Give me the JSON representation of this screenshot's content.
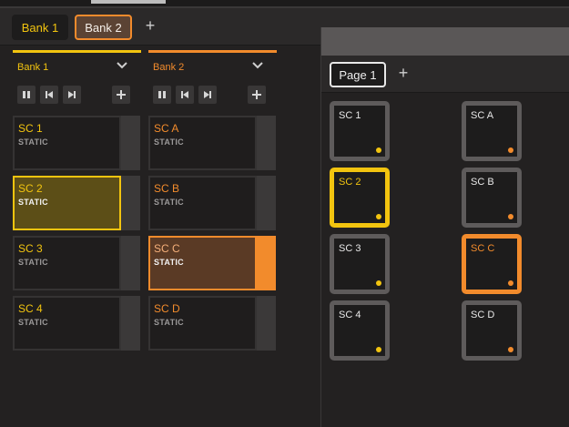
{
  "banks": {
    "tabs": [
      {
        "label": "Bank 1"
      },
      {
        "label": "Bank 2"
      }
    ],
    "add_icon": "plus-icon"
  },
  "columns": [
    {
      "title": "Bank 1",
      "accent": "#f2c40f",
      "clips": [
        {
          "name": "SC 1",
          "mode": "STATIC"
        },
        {
          "name": "SC 2",
          "mode": "STATIC"
        },
        {
          "name": "SC 3",
          "mode": "STATIC"
        },
        {
          "name": "SC 4",
          "mode": "STATIC"
        }
      ]
    },
    {
      "title": "Bank 2",
      "accent": "#f28b2c",
      "clips": [
        {
          "name": "SC A",
          "mode": "STATIC"
        },
        {
          "name": "SC B",
          "mode": "STATIC"
        },
        {
          "name": "SC C",
          "mode": "STATIC"
        },
        {
          "name": "SC D",
          "mode": "STATIC"
        }
      ]
    }
  ],
  "transport_icons": [
    "pause-icon",
    "skip-back-icon",
    "skip-forward-icon",
    "plus-icon"
  ],
  "page": {
    "tab_label": "Page 1",
    "pads_left": [
      {
        "name": "SC 1"
      },
      {
        "name": "SC 2"
      },
      {
        "name": "SC 3"
      },
      {
        "name": "SC 4"
      }
    ],
    "pads_right": [
      {
        "name": "SC A"
      },
      {
        "name": "SC B"
      },
      {
        "name": "SC C"
      },
      {
        "name": "SC D"
      }
    ]
  },
  "colors": {
    "bank1": "#f2c40f",
    "bank2": "#f28b2c"
  }
}
